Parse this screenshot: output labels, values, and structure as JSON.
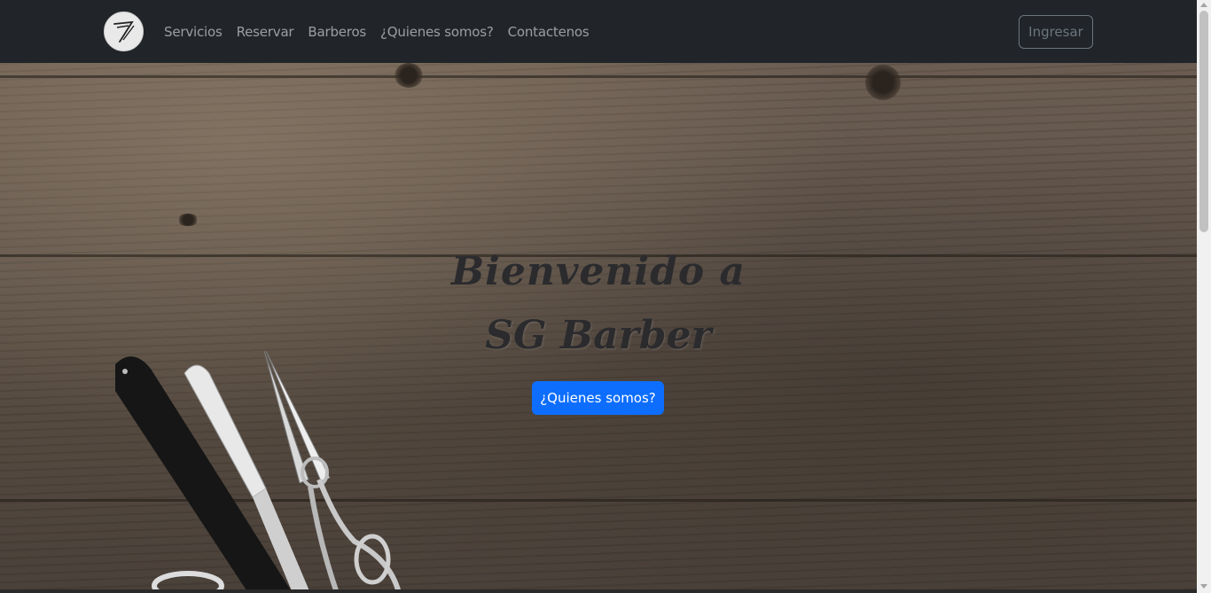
{
  "navbar": {
    "brand_icon": "razor-logo-icon",
    "links": [
      "Servicios",
      "Reservar",
      "Barberos",
      "¿Quienes somos?",
      "Contactenos"
    ],
    "login_label": "Ingresar"
  },
  "hero": {
    "title_line1": "Bienvenido a",
    "title_line2": "SG Barber",
    "cta_label": "¿Quienes somos?",
    "background": "wood-planks-with-razor-and-scissors"
  },
  "colors": {
    "navbar_bg": "#212529",
    "cta_bg": "#0d6efd",
    "link_color": "rgba(255,255,255,0.55)"
  }
}
